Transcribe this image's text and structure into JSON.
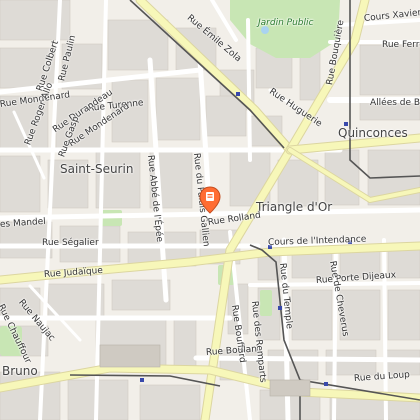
{
  "map": {
    "colors": {
      "background": "#f2efe9",
      "block": "#dedbd6",
      "street": "#ffffff",
      "major_road": "#f7f7b9",
      "major_road_casing": "#dcd6a0",
      "park": "#c8e6b4",
      "tram_line": "#555555",
      "marker": "#ff6d33"
    },
    "areas": {
      "saint_seurin": "Saint-Seurin",
      "triangle": "Triangle d'Or",
      "quinconces": "Quinconces",
      "bruno": "Bruno"
    },
    "parks": {
      "jardin_public": "Jardin Public"
    },
    "streets": {
      "emile_zola": "Rue Émile Zola",
      "cours_xavier": "Cours Xavier",
      "rue_ferrere": "Rue Ferrère",
      "rue_colbert": "Rue Colbert",
      "rue_paulin": "Rue Paulin",
      "rue_mondenard_w": "Rue Mondenard",
      "rue_turenne": "Rue Turenne",
      "rue_huguerie": "Rue Huguerie",
      "rue_bouquiere": "Rue Bouquière",
      "allees_de_bristol": "Allées de Bri",
      "rue_rolland": "Rue Rolland",
      "rue_mandel": "es Mandel",
      "rue_segalier": "Rue Ségalier",
      "rue_judaique": "Rue Judaïque",
      "rue_durandeau": "Rue Durandeau",
      "rue_mondenard": "Rue Mondenard",
      "rue_roger_allo": "Rue Roger Allo",
      "rue_gaspard": "Rue Gasp",
      "rue_abbe_epee": "Rue Abbé de l'Épée",
      "rue_du_palais": "Rue du Palais Gallien",
      "cours_intendance": "Cours de l'Intendance",
      "rue_du_temple": "Rue du Temple",
      "rue_porte_dijeaux": "Rue Porte Dijeaux",
      "rue_des_remparts": "Rue des Remparts",
      "rue_bouffard": "Rue Bouffard",
      "rue_boulan": "Rue Boulan",
      "rue_du_loup": "Rue du Loup",
      "rue_naujac": "Rue Naujac",
      "rue_chauffour": "Rue Chauffour",
      "rue_amedee": "Rue Amédée",
      "rue_de_cheverus": "Rue de Cheverus",
      "rue_bouquier": "Rue Bouquière"
    },
    "marker": {
      "icon": "map-pin-icon"
    }
  }
}
